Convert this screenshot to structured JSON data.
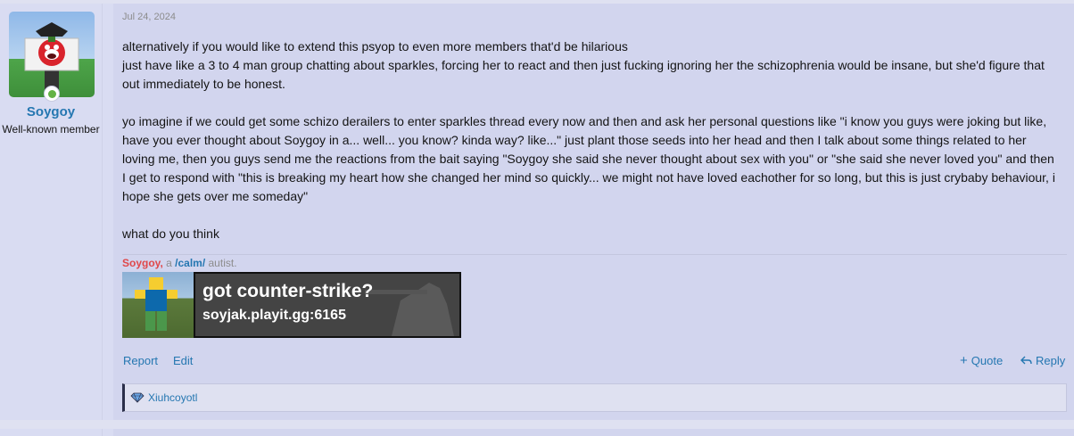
{
  "user": {
    "name": "Soygoy",
    "title": "Well-known member",
    "online_color": "#63b245"
  },
  "post": {
    "date": "Jul 24, 2024",
    "paragraphs": [
      "alternatively if you would like to extend this psyop to even more members that'd be hilarious\njust have like a 3 to 4 man group chatting about sparkles, forcing her to react and then just fucking ignoring her the schizophrenia would be insane, but she'd figure that out immediately to be honest.",
      "yo imagine if we could get some schizo derailers to enter sparkles thread every now and then and ask her personal questions like \"i know you guys were joking but like, have you ever thought about Soygoy in a... well... you know? kinda way? like...\" just plant those seeds into her head and then I talk about some things related to her loving me, then you guys send me the reactions from the bait saying \"Soygoy she said she never thought about sex with you\" or \"she said she never loved you\" and then I get to respond with \"this is breaking my heart how she changed her mind so quickly... we might not have loved eachother for so long, but this is just crybaby behaviour, i hope she gets over me someday\"",
      "what do you think"
    ]
  },
  "signature": {
    "name": "Soygoy,",
    "a": " a ",
    "board": "/calm/",
    "rest": " autist.",
    "banner_line1": "got counter-strike?",
    "banner_line2": "soyjak.playit.gg:6165"
  },
  "actions": {
    "report": "Report",
    "edit": "Edit",
    "quote": "Quote",
    "reply": "Reply"
  },
  "reactions": {
    "user": "Xiuhcoyotl"
  }
}
